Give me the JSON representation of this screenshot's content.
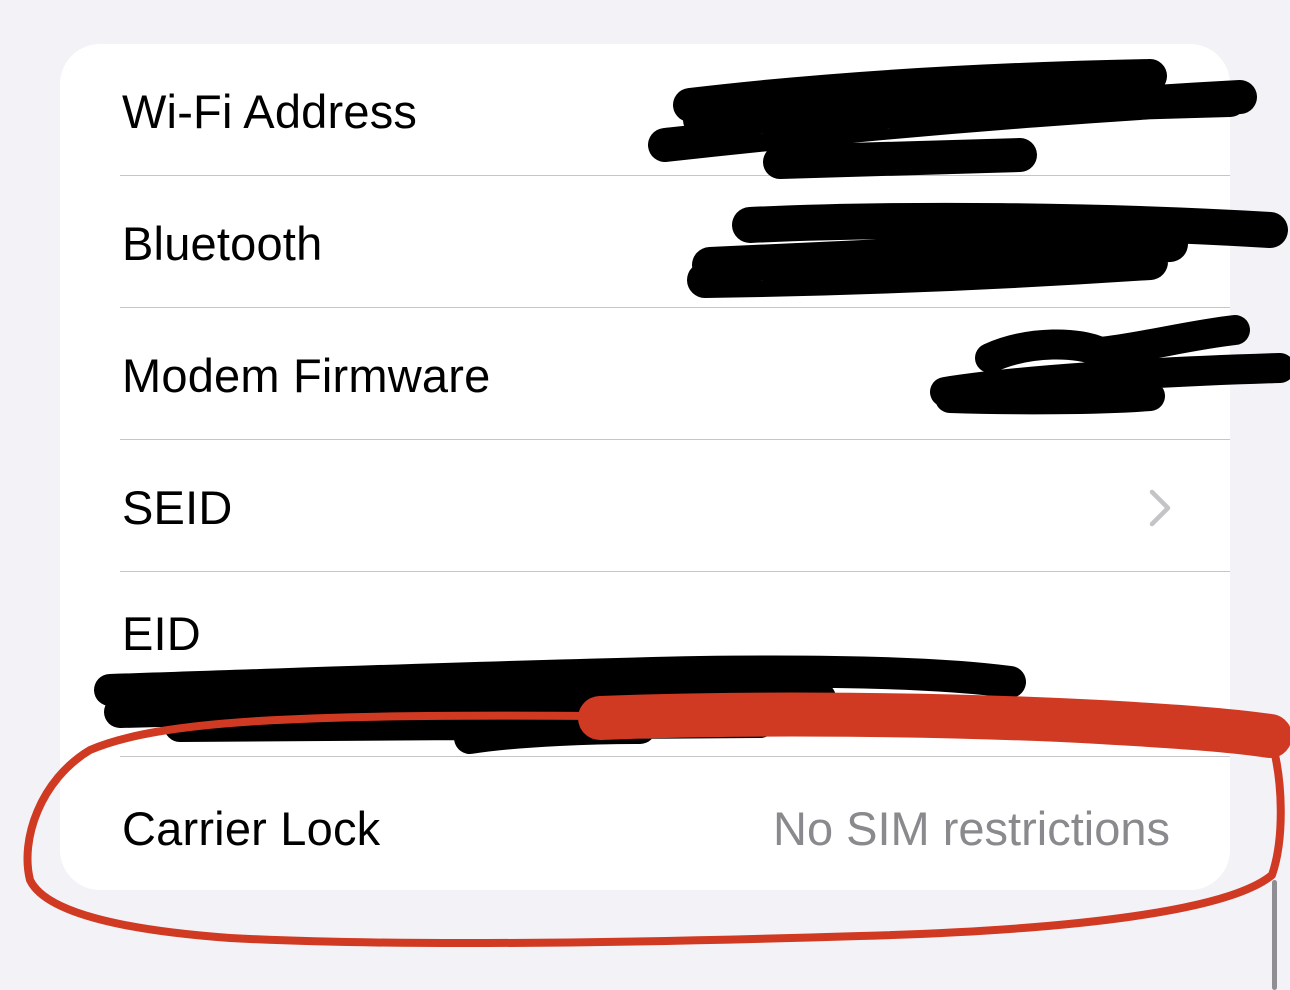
{
  "about_list": {
    "rows": [
      {
        "label": "Wi-Fi Address",
        "value": "",
        "redacted": true
      },
      {
        "label": "Bluetooth",
        "value": "",
        "redacted": true
      },
      {
        "label": "Modem Firmware",
        "value": "",
        "redacted": true
      },
      {
        "label": "SEID",
        "value": "",
        "has_chevron": true
      },
      {
        "label": "EID",
        "value": "",
        "redacted": true
      },
      {
        "label": "Carrier Lock",
        "value": "No SIM restrictions"
      }
    ]
  },
  "icons": {
    "seid_chevron": "chevron-right-icon"
  },
  "colors": {
    "background": "#f2f2f7",
    "card": "#ffffff",
    "secondary_text": "#8a8a8e",
    "separator": "#c6c6c8",
    "redaction": "#000000",
    "annotation": "#d03a22"
  }
}
